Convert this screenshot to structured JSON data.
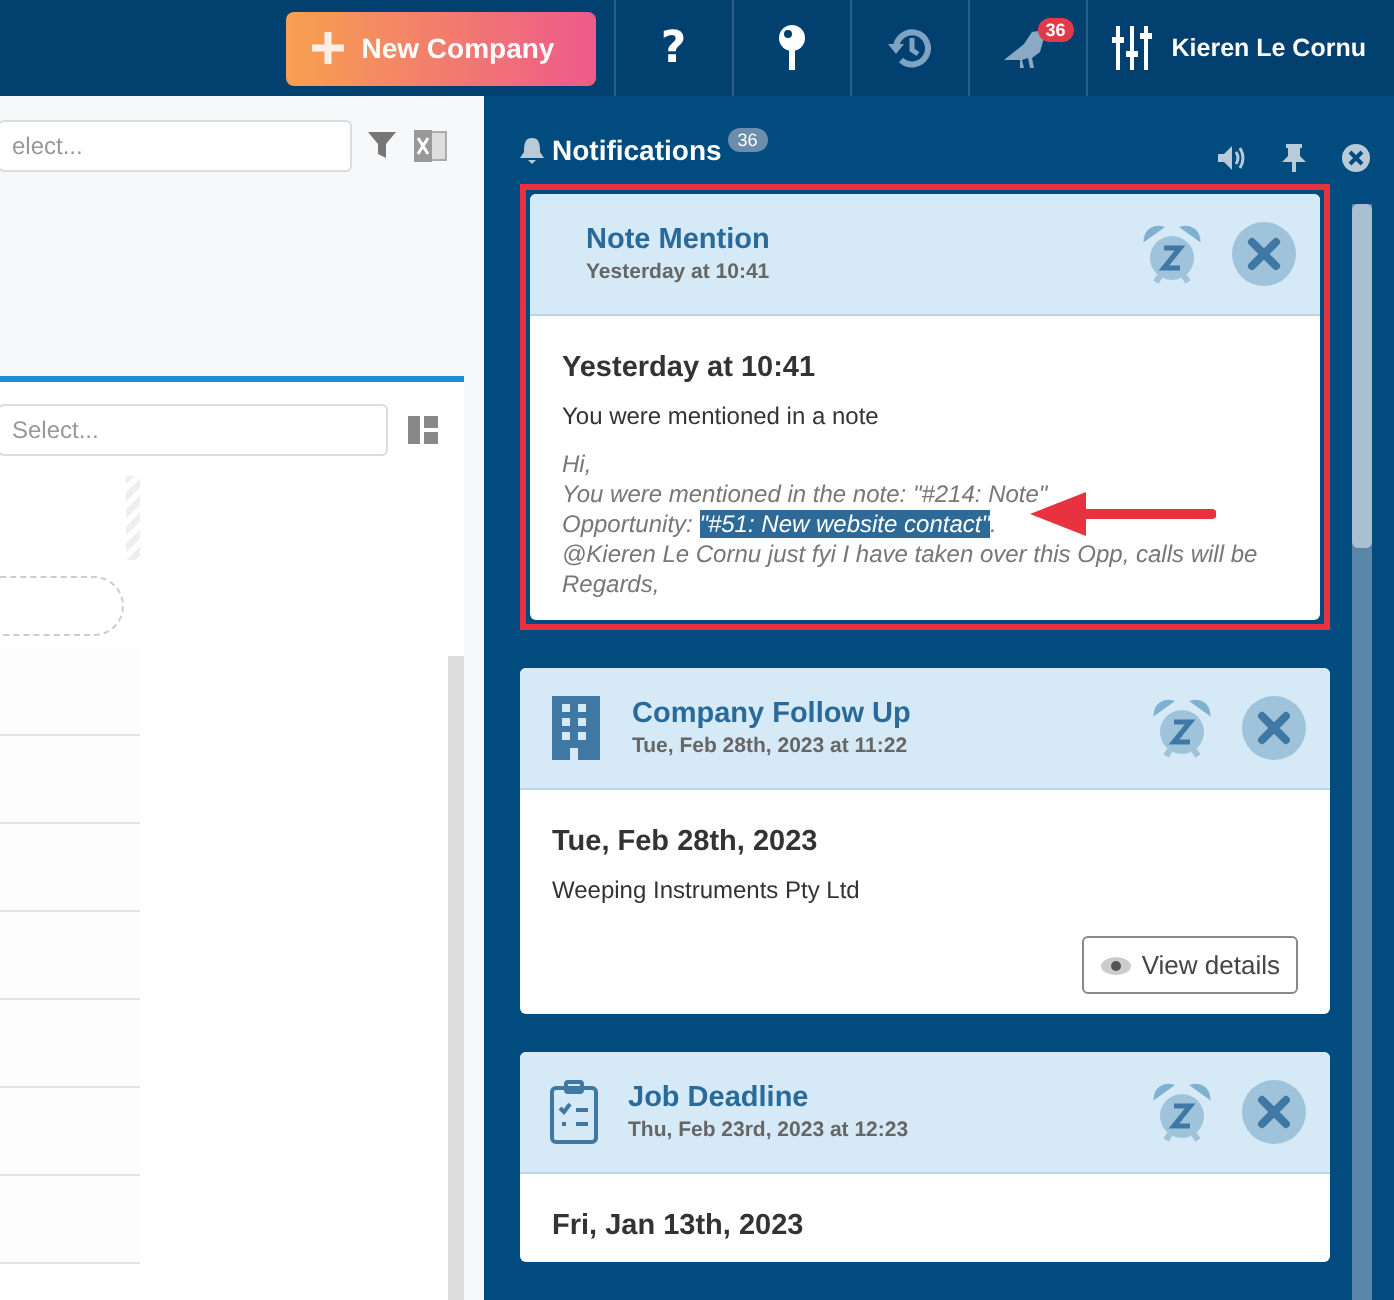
{
  "topbar": {
    "new_button": "New Company",
    "help": "?",
    "alerts_badge": "36",
    "user": "Kieren Le Cornu"
  },
  "left_panel": {
    "search": {
      "placeholder": "elect..."
    },
    "filter": {
      "placeholder": "Select..."
    }
  },
  "notifications": {
    "title": "Notifications",
    "count": "36",
    "cards": [
      {
        "kind": "note",
        "annotated": true,
        "title": "Note Mention",
        "subtitle": "Yesterday at 10:41",
        "heading": "Yesterday at 10:41",
        "text": "You were mentioned in a note",
        "note_lines": [
          {
            "text": "Hi,"
          },
          {
            "text": "You were mentioned in the note: \"#214: Note\""
          },
          {
            "text": "Opportunity: ",
            "highlight": "\"#51: New website contact\"",
            "after": "."
          },
          {
            "text": "@Kieren Le Cornu just fyi I have taken over this Opp, calls will be"
          },
          {
            "text": "Regards,"
          }
        ]
      },
      {
        "kind": "company",
        "annotated": false,
        "title": "Company Follow Up",
        "subtitle": "Tue, Feb 28th, 2023 at 11:22",
        "heading": "Tue, Feb 28th, 2023",
        "text": "Weeping Instruments Pty Ltd",
        "button": "View details"
      },
      {
        "kind": "job",
        "annotated": false,
        "title": "Job Deadline",
        "subtitle": "Thu, Feb 23rd, 2023 at 12:23",
        "heading": "Fri, Jan 13th, 2023"
      }
    ]
  }
}
